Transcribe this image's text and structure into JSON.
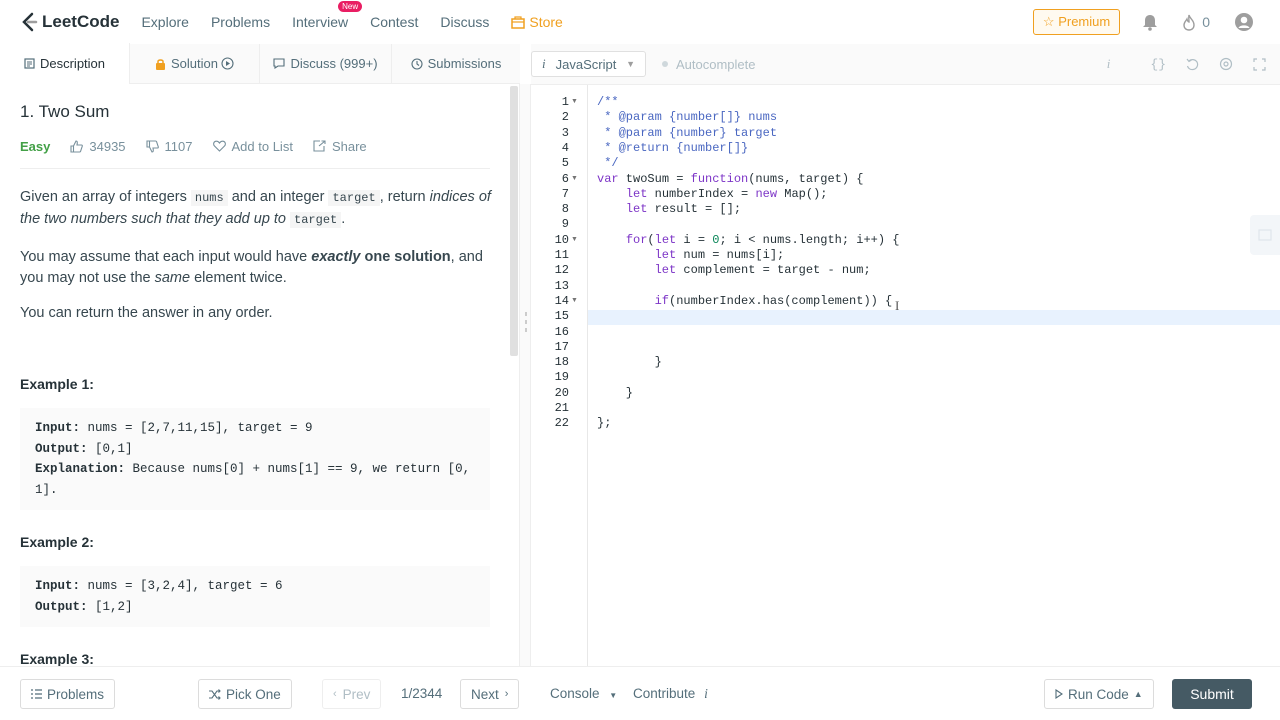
{
  "topnav": {
    "logo": "LeetCode",
    "items": [
      {
        "label": "Explore"
      },
      {
        "label": "Problems"
      },
      {
        "label": "Interview",
        "badge": "New"
      },
      {
        "label": "Contest"
      },
      {
        "label": "Discuss"
      }
    ],
    "store": "Store",
    "premium": "Premium",
    "streak_count": "0"
  },
  "left_tabs": {
    "description": "Description",
    "solution": "Solution",
    "discuss": "Discuss (999+)",
    "submissions": "Submissions"
  },
  "problem": {
    "title": "1. Two Sum",
    "difficulty": "Easy",
    "likes": "34935",
    "dislikes": "1107",
    "add_to_list": "Add to List",
    "share": "Share",
    "p1_a": "Given an array of integers ",
    "p1_code1": "nums",
    "p1_b": " and an integer ",
    "p1_code2": "target",
    "p1_c": ", return ",
    "p1_em": "indices of the two numbers such that they add up to",
    "p1_code3": "target",
    "p1_d": ".",
    "p2_a": "You may assume that each input would have ",
    "p2_em": "exactly",
    "p2_b": " one solution",
    "p2_c": ", and you may not use the ",
    "p2_em2": "same",
    "p2_d": " element twice.",
    "p3": "You can return the answer in any order.",
    "examples": [
      {
        "title": "Example 1:",
        "input_label": "Input:",
        "input": " nums = [2,7,11,15], target = 9",
        "output_label": "Output:",
        "output": " [0,1]",
        "explanation_label": "Explanation:",
        "explanation": " Because nums[0] + nums[1] == 9, we return [0,",
        "explanation2": "1]."
      },
      {
        "title": "Example 2:",
        "input_label": "Input:",
        "input": " nums = [3,2,4], target = 6",
        "output_label": "Output:",
        "output": " [1,2]"
      },
      {
        "title": "Example 3:"
      }
    ]
  },
  "editor": {
    "language": "JavaScript",
    "autocomplete": "Autocomplete",
    "code_lines": [
      "/**",
      " * @param {number[]} nums",
      " * @param {number} target",
      " * @return {number[]}",
      " */",
      "var twoSum = function(nums, target) {",
      "    let numberIndex = new Map();",
      "    let result = [];",
      "",
      "    for(let i = 0; i < nums.length; i++) {",
      "        let num = nums[i];",
      "        let complement = target - num;",
      "",
      "        if(numberIndex.has(complement)) {",
      "",
      "",
      "",
      "        }",
      "",
      "    }",
      "",
      "};"
    ]
  },
  "bottombar": {
    "problems": "Problems",
    "pick_one": "Pick One",
    "prev": "Prev",
    "page": "1/2344",
    "next": "Next",
    "console": "Console",
    "contribute": "Contribute",
    "run_code": "Run Code",
    "submit": "Submit"
  }
}
